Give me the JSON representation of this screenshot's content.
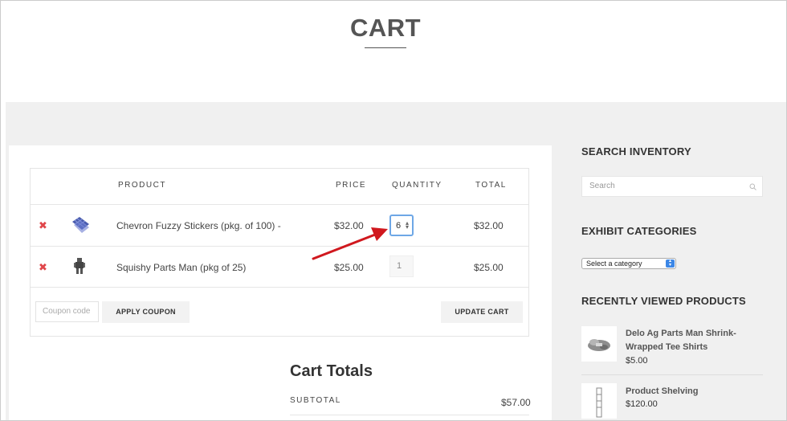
{
  "page": {
    "title": "CART"
  },
  "cart": {
    "headers": {
      "product": "PRODUCT",
      "price": "PRICE",
      "quantity": "QUANTITY",
      "total": "TOTAL"
    },
    "rows": [
      {
        "name": "Chevron Fuzzy Stickers (pkg. of 100) -",
        "price": "$32.00",
        "quantity": "6",
        "total": "$32.00"
      },
      {
        "name": "Squishy Parts Man (pkg of 25)",
        "price": "$25.00",
        "quantity": "1",
        "total": "$25.00"
      }
    ],
    "remove_glyph": "✖",
    "coupon_placeholder": "Coupon code",
    "apply_coupon_label": "APPLY COUPON",
    "update_cart_label": "UPDATE CART"
  },
  "totals": {
    "title": "Cart Totals",
    "subtotal_label": "SUBTOTAL",
    "subtotal_value": "$57.00"
  },
  "sidebar": {
    "search_heading": "SEARCH INVENTORY",
    "search_placeholder": "Search",
    "categories_heading": "EXHIBIT CATEGORIES",
    "category_select": "Select a category",
    "recent_heading": "RECENTLY VIEWED PRODUCTS",
    "recent": [
      {
        "name_line1": "Delo Ag Parts Man Shrink-",
        "name_line2": "Wrapped Tee Shirts",
        "price": "$5.00"
      },
      {
        "name_line1": "Product Shelving",
        "price": "$120.00"
      }
    ]
  },
  "colors": {
    "remove": "#e0464a",
    "focus_border": "#6ea7e6",
    "arrow": "#d0181e",
    "select_button": "#3c87e6"
  },
  "icons": [
    "remove-icon",
    "search-icon",
    "select-arrows-icon",
    "spinner-icon",
    "annotation-arrow-icon"
  ]
}
